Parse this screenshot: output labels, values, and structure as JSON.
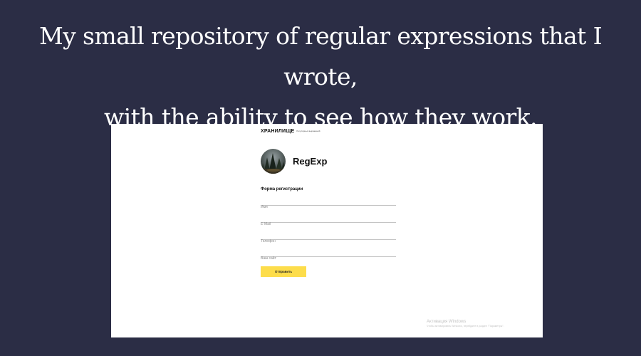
{
  "headline": {
    "line1": "My small repository of regular expressions that I wrote,",
    "line2": "with the ability to see how they work."
  },
  "site": {
    "brand": "ХРАНИЛИЩЕ",
    "brand_sub": "Регулярных выражений"
  },
  "profile": {
    "name": "RegExp",
    "avatar_icon": "forest-photo-avatar"
  },
  "form": {
    "title": "Форма регистрации",
    "fields": {
      "name": {
        "placeholder": "Имя",
        "value": ""
      },
      "email": {
        "placeholder": "E-Mail",
        "value": ""
      },
      "phone": {
        "placeholder": "Телефон",
        "value": ""
      },
      "site": {
        "placeholder": "Ваш сайт",
        "value": ""
      }
    },
    "submit_label": "Отправить"
  },
  "watermark": {
    "title": "Активация Windows",
    "subtitle": "Чтобы активировать Windows, перейдите в раздел \"Параметры\"."
  },
  "colors": {
    "background": "#2b2d45",
    "page": "#ffffff",
    "button": "#fddd4b"
  }
}
